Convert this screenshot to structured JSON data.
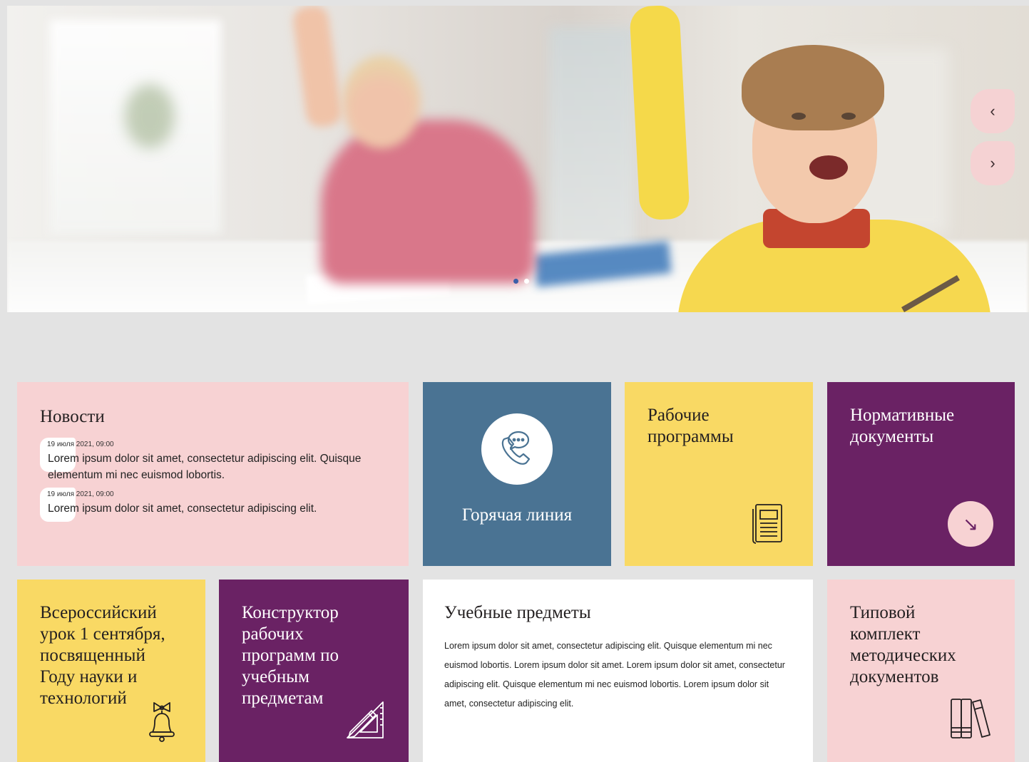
{
  "hero": {
    "prev_arrow": "‹",
    "next_arrow": "›",
    "dots_count": 2
  },
  "news": {
    "title": "Новости",
    "items": [
      {
        "date": "19 июля 2021, 09:00",
        "text": "Lorem ipsum dolor sit amet, consectetur adipiscing elit. Quisque elementum mi nec euismod lobortis."
      },
      {
        "date": "19 июля 2021, 09:00",
        "text": "Lorem ipsum dolor sit amet, consectetur adipiscing elit."
      }
    ]
  },
  "hotline": {
    "label": "Горячая линия",
    "icon": "phone-chat-icon"
  },
  "work_programs": {
    "title": "Рабочие программы",
    "icon": "document-icon"
  },
  "normative": {
    "title": "Нормативные документы",
    "button": "↘",
    "icon": "arrow-down-right-icon"
  },
  "lesson": {
    "title": "Всероссийский урок 1 сентября, посвященный Году науки и технологий",
    "icon": "bell-icon"
  },
  "constructor": {
    "title": "Конструктор рабочих программ по учебным предметам",
    "icon": "ruler-triangle-icon"
  },
  "subjects": {
    "title": "Учебные предметы",
    "text": "Lorem ipsum dolor sit amet, consectetur adipiscing elit. Quisque elementum mi nec euismod lobortis. Lorem ipsum dolor sit amet. Lorem ipsum dolor sit amet, consectetur adipiscing elit. Quisque elementum mi nec euismod lobortis. Lorem ipsum dolor sit amet, consectetur adipiscing elit."
  },
  "kit": {
    "title": "Типовой комплект методических документов",
    "icon": "books-icon"
  },
  "colors": {
    "pink": "#f7d2d3",
    "blue": "#4a7393",
    "yellow": "#f9d964",
    "purple": "#6a2264",
    "background": "#e3e3e3"
  }
}
